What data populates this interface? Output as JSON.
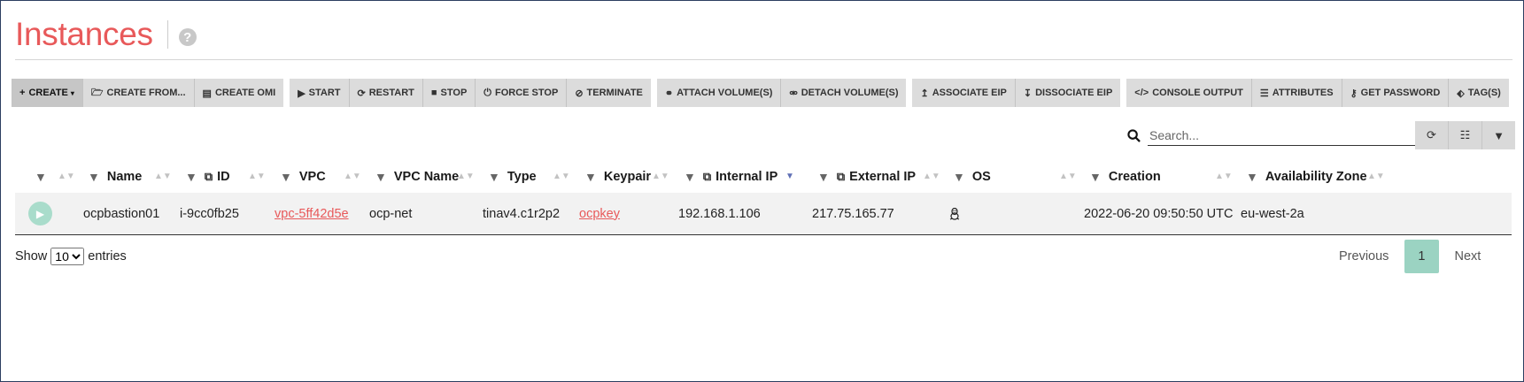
{
  "header": {
    "title": "Instances",
    "help": "?"
  },
  "toolbar": {
    "groups": [
      [
        {
          "icon": "+",
          "label": "CREATE",
          "caret": "▾"
        },
        {
          "icon": "🗁",
          "label": "CREATE FROM..."
        },
        {
          "icon": "▤",
          "label": "CREATE OMI"
        }
      ],
      [
        {
          "icon": "▶",
          "label": "START"
        },
        {
          "icon": "⟳",
          "label": "RESTART"
        },
        {
          "icon": "■",
          "label": "STOP"
        },
        {
          "icon": "⏻",
          "label": "FORCE STOP"
        },
        {
          "icon": "⊘",
          "label": "TERMINATE"
        }
      ],
      [
        {
          "icon": "⚭",
          "label": "ATTACH VOLUME(S)"
        },
        {
          "icon": "⚮",
          "label": "DETACH VOLUME(S)"
        }
      ],
      [
        {
          "icon": "↥",
          "label": "ASSOCIATE EIP"
        },
        {
          "icon": "↧",
          "label": "DISSOCIATE EIP"
        }
      ],
      [
        {
          "icon": "</>",
          "label": "CONSOLE OUTPUT"
        },
        {
          "icon": "☰",
          "label": "ATTRIBUTES"
        },
        {
          "icon": "⚷",
          "label": "GET PASSWORD"
        },
        {
          "icon": "⬖",
          "label": "TAG(S)"
        }
      ]
    ]
  },
  "search": {
    "placeholder": "Search...",
    "icon": "search-icon"
  },
  "view_buttons": {
    "refresh": "⟳",
    "columns": "☷",
    "filter": "▼"
  },
  "table": {
    "columns": [
      {
        "label": "",
        "copy": false
      },
      {
        "label": "Name",
        "copy": false
      },
      {
        "label": "ID",
        "copy": true
      },
      {
        "label": "VPC",
        "copy": false
      },
      {
        "label": "VPC Name",
        "copy": false
      },
      {
        "label": "Type",
        "copy": false
      },
      {
        "label": "Keypair",
        "copy": false
      },
      {
        "label": "Internal IP",
        "copy": true,
        "sorted": "desc"
      },
      {
        "label": "External IP",
        "copy": true
      },
      {
        "label": "OS",
        "copy": false
      },
      {
        "label": "Creation",
        "copy": false
      },
      {
        "label": "Availability Zone",
        "copy": false
      }
    ],
    "rows": [
      {
        "status": "running",
        "name": "ocpbastion01",
        "id": "i-9cc0fb25",
        "vpc": "vpc-5ff42d5e",
        "vpc_name": "ocp-net",
        "type": "tinav4.c1r2p2",
        "keypair": "ocpkey",
        "internal_ip": "192.168.1.106",
        "external_ip": "217.75.165.77",
        "os": "linux-icon",
        "creation": "2022-06-20 09:50:50 UTC",
        "az": "eu-west-2a"
      }
    ]
  },
  "footer": {
    "show": "Show",
    "page_size": "10",
    "entries": "entries"
  },
  "pagination": {
    "previous": "Previous",
    "current": "1",
    "next": "Next"
  },
  "colors": {
    "accent": "#e8595a",
    "active_page": "#9bd3c2",
    "toolbar_bg": "#dcdcdc"
  }
}
